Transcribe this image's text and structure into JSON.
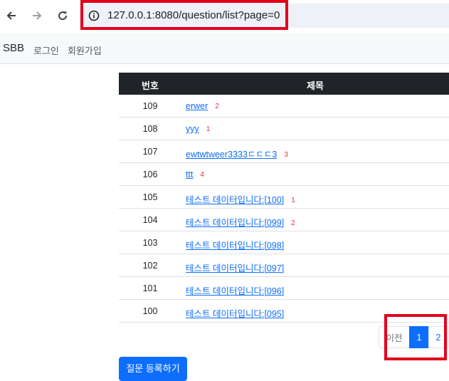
{
  "browser": {
    "url": "127.0.0.1:8080/question/list?page=0",
    "icons": {
      "back": "arrow-left-icon",
      "forward": "arrow-right-icon",
      "reload": "reload-icon",
      "site_info": "info-icon"
    }
  },
  "navbar": {
    "brand": "SBB",
    "links": [
      {
        "label": "로그인"
      },
      {
        "label": "회원가입"
      }
    ]
  },
  "table": {
    "headers": {
      "number": "번호",
      "title": "제목"
    },
    "rows": [
      {
        "number": "109",
        "title": "erwer",
        "answers": "2"
      },
      {
        "number": "108",
        "title": "yyy",
        "answers": "1"
      },
      {
        "number": "107",
        "title": "ewtwtweer3333ㄷㄷㄷ3",
        "answers": "3"
      },
      {
        "number": "106",
        "title": "ttt",
        "answers": "4"
      },
      {
        "number": "105",
        "title": "테스트 데이터입니다:[100]",
        "answers": "1"
      },
      {
        "number": "104",
        "title": "테스트 데이터입니다:[099]",
        "answers": "2"
      },
      {
        "number": "103",
        "title": "테스트 데이터입니다:[098]",
        "answers": ""
      },
      {
        "number": "102",
        "title": "테스트 데이터입니다:[097]",
        "answers": ""
      },
      {
        "number": "101",
        "title": "테스트 데이터입니다:[096]",
        "answers": ""
      },
      {
        "number": "100",
        "title": "테스트 데이터입니다:[095]",
        "answers": ""
      }
    ]
  },
  "pagination": {
    "prev": "이전",
    "current": "1",
    "next": "2"
  },
  "actions": {
    "ask_button": "질문 등록하기"
  },
  "colors": {
    "highlight": "#e3001b",
    "accent": "#0d6efd",
    "header_bg": "#212529",
    "badge": "#dc3545"
  }
}
